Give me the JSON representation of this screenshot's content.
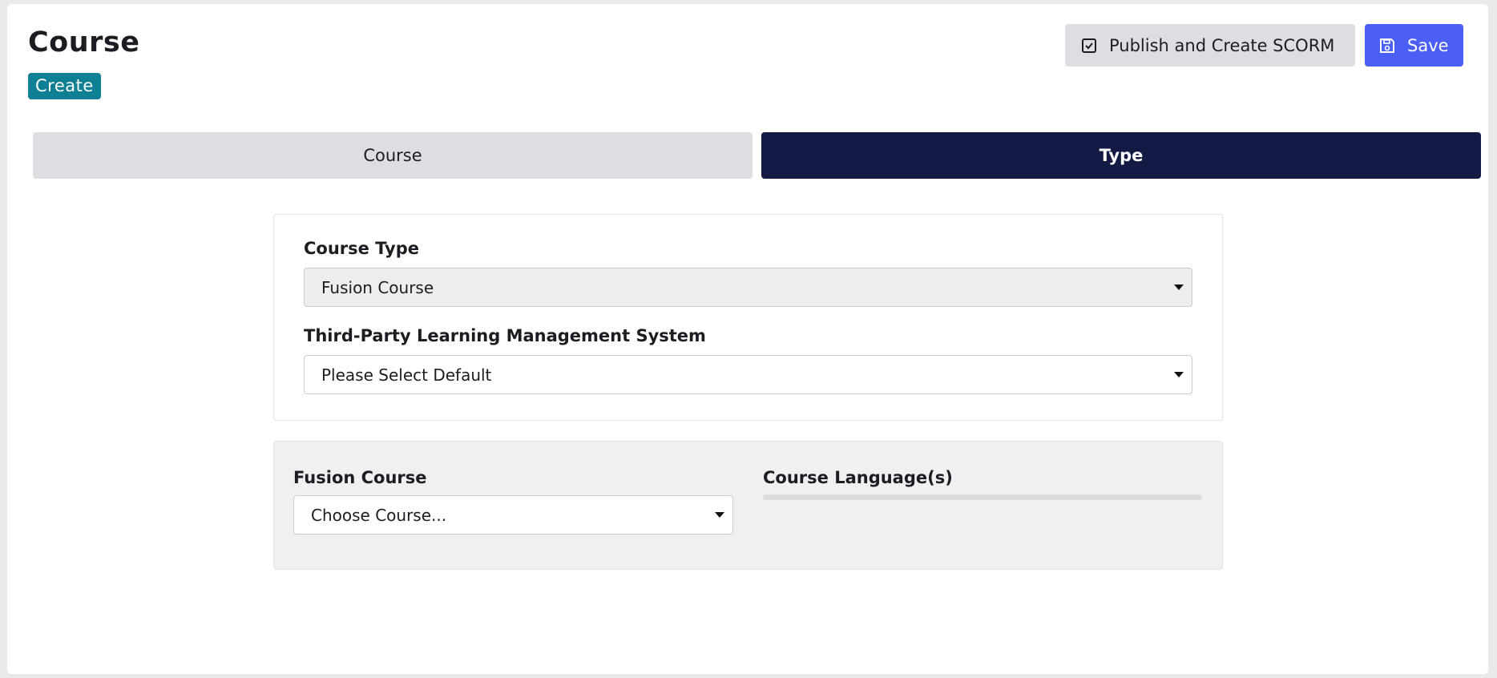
{
  "header": {
    "title": "Course",
    "badge": "Create",
    "publish_label": "Publish and Create SCORM",
    "save_label": "Save"
  },
  "tabs": [
    {
      "label": "Course",
      "active": false
    },
    {
      "label": "Type",
      "active": true
    }
  ],
  "type_panel": {
    "course_type_label": "Course Type",
    "course_type_value": "Fusion Course",
    "lms_label": "Third-Party Learning Management System",
    "lms_value": "Please Select Default"
  },
  "fusion_panel": {
    "fusion_course_label": "Fusion Course",
    "fusion_course_value": "Choose Course...",
    "languages_label": "Course Language(s)"
  },
  "colors": {
    "accent": "#4a5ff5",
    "badge": "#0f7f93",
    "active_tab": "#131b45"
  }
}
